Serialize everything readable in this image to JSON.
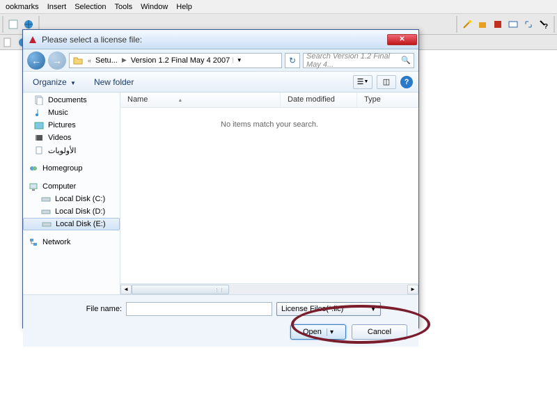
{
  "menubar": [
    "ookmarks",
    "Insert",
    "Selection",
    "Tools",
    "Window",
    "Help"
  ],
  "dialog": {
    "title": "Please select a license file:",
    "breadcrumb": {
      "first": "Setu...",
      "second": "Version 1.2 Final May 4 2007"
    },
    "search_placeholder": "Search Version 1.2 Final May 4...",
    "organize": "Organize",
    "new_folder": "New folder",
    "columns": {
      "name": "Name",
      "date": "Date modified",
      "type": "Type"
    },
    "empty_msg": "No items match your search.",
    "sidebar": {
      "docs": "Documents",
      "music": "Music",
      "pictures": "Pictures",
      "videos": "Videos",
      "arabic": "الأولويات",
      "homegroup": "Homegroup",
      "computer": "Computer",
      "c": "Local Disk (C:)",
      "d": "Local Disk (D:)",
      "e": "Local Disk (E:)",
      "network": "Network"
    },
    "filename_label": "File name:",
    "filename_value": "",
    "filter": "License Files(*.lic)",
    "open": "Open",
    "cancel": "Cancel"
  }
}
